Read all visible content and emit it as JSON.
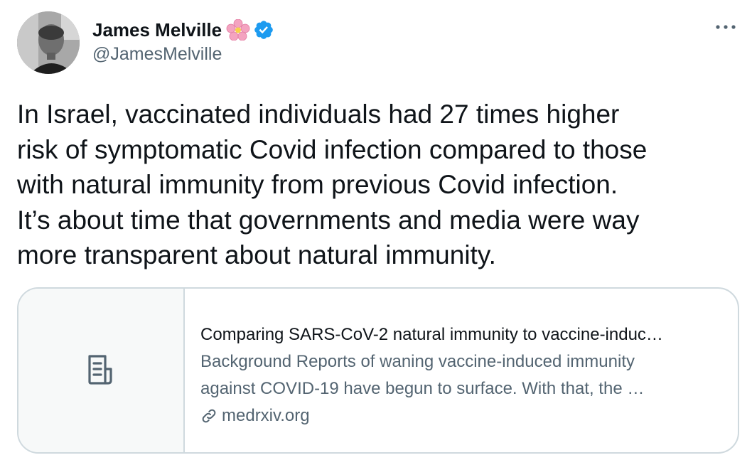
{
  "author": {
    "display_name": "James Melville",
    "handle": "@JamesMelville"
  },
  "tweet": {
    "text": "In Israel, vaccinated individuals had 27 times higher\nrisk of symptomatic Covid infection compared to those\nwith natural immunity from previous Covid infection.\nIt’s about time that governments and media were way\nmore transparent about natural immunity."
  },
  "card": {
    "title": "Comparing SARS-CoV-2 natural immunity to vaccine-induc…",
    "description_line1": "Background Reports of waning vaccine-induced immunity",
    "description_line2": "against COVID-19 have begun to surface. With that, the …",
    "domain": "medrxiv.org"
  },
  "icons": {
    "more": "more-horizontal-icon",
    "verified": "verified-badge-icon",
    "flower": "cherry-blossom-icon",
    "article": "article-icon",
    "link": "link-icon"
  },
  "colors": {
    "text_primary": "#0f1419",
    "text_secondary": "#536471",
    "verified_blue": "#1d9bf0",
    "border": "#cfd9de"
  }
}
